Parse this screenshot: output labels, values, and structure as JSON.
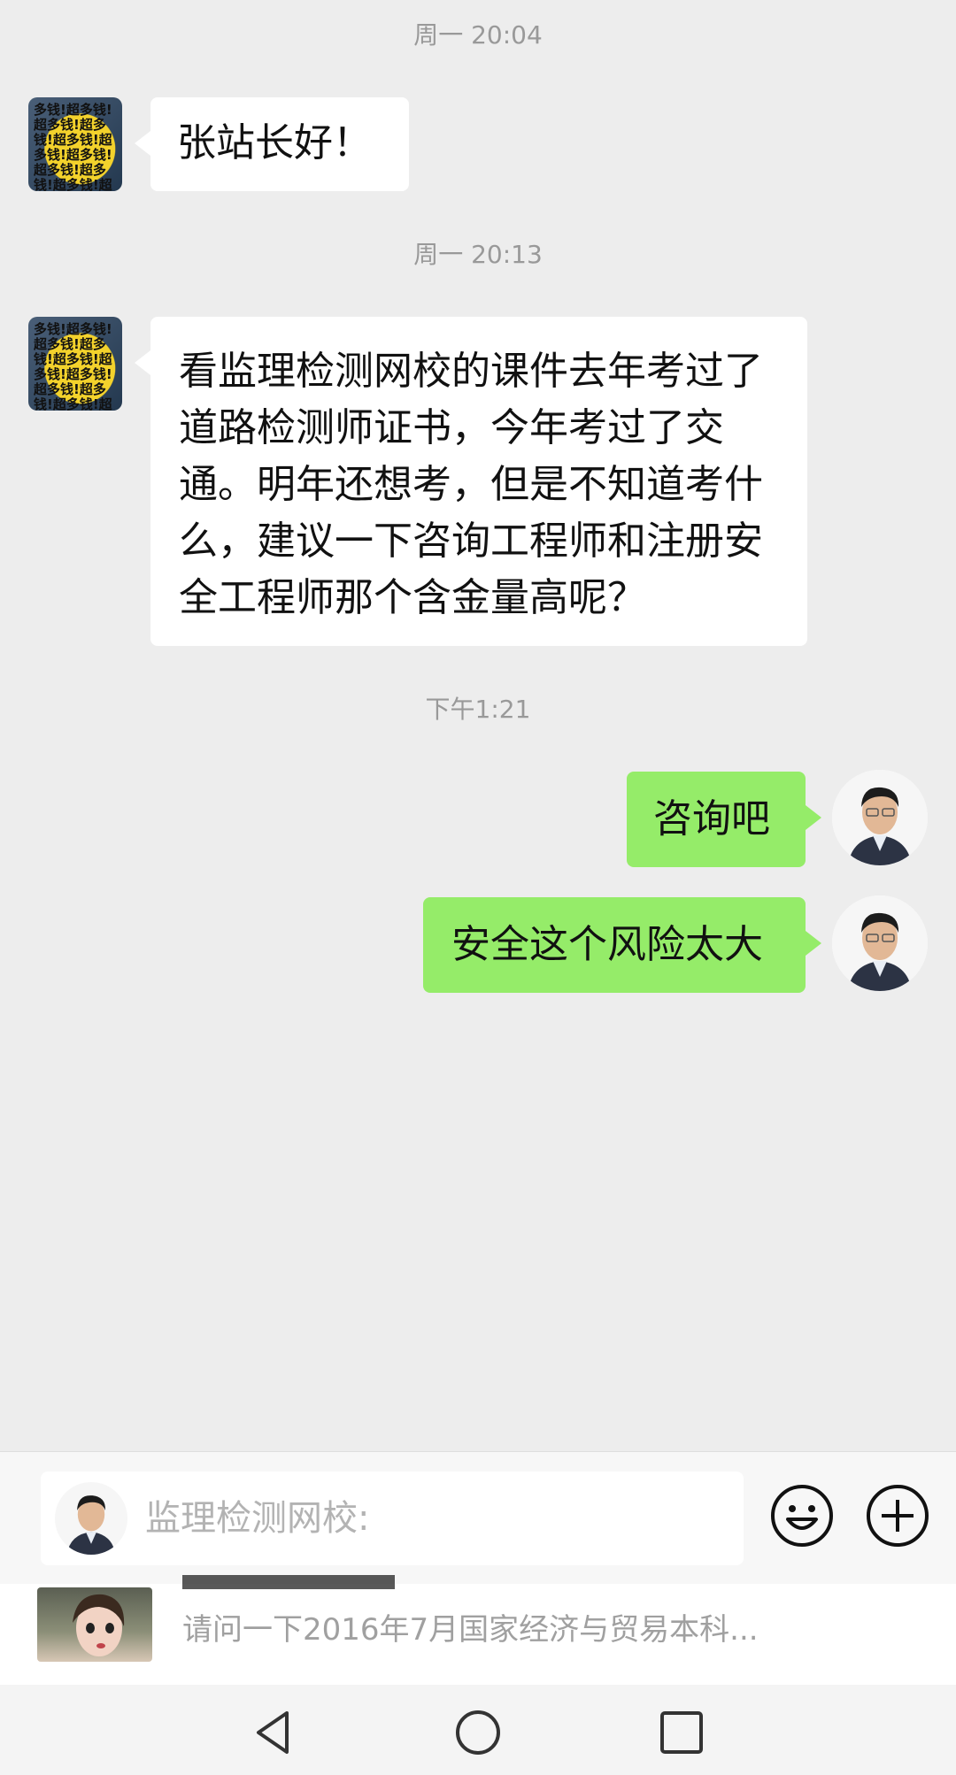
{
  "messages": [
    {
      "timestamp": "周一 20:04"
    },
    {
      "side": "left",
      "text": "张站长好！"
    },
    {
      "timestamp": "周一 20:13"
    },
    {
      "side": "left",
      "lines": [
        "看监理检测网校的课件去年考过了",
        "道路检测师证书，今年考过了交",
        "通。明年还想考，但是不知道考什",
        "么，建议一下咨询工程师和注册安",
        "全工程师那个含金量高呢？"
      ]
    },
    {
      "timestamp": "下午1:21"
    },
    {
      "side": "right",
      "text": "咨询吧"
    },
    {
      "side": "right",
      "text": "安全这个风险太大"
    }
  ],
  "left_avatar": {
    "pattern_text": "多钱!超多钱!超多钱!超多钱!超多钱!超多钱!超多钱!超多钱!超多钱!超多钱!超多钱!超多钱!超多钱!超"
  },
  "input": {
    "placeholder": "监理检测网校:"
  },
  "icons": {
    "emoji": "emoji-icon",
    "plus": "plus-icon"
  },
  "reference": {
    "text": "请问一下2016年7月国家经济与贸易本科..."
  },
  "navbar": {
    "back": "back-icon",
    "home": "home-icon",
    "recent": "recent-apps-icon"
  },
  "colors": {
    "background": "#ededed",
    "sent_bubble": "#95ec69",
    "received_bubble": "#ffffff"
  }
}
